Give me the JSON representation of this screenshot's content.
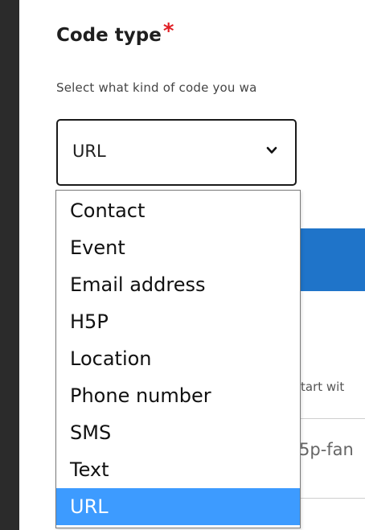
{
  "field": {
    "label": "Code type",
    "required_marker": "*",
    "description": "Select what kind of code you wa"
  },
  "select": {
    "value": "URL",
    "icon": "chevron-down-icon"
  },
  "dropdown": {
    "options": [
      {
        "label": "Contact"
      },
      {
        "label": "Event"
      },
      {
        "label": "Email address"
      },
      {
        "label": "H5P"
      },
      {
        "label": "Location"
      },
      {
        "label": "Phone number"
      },
      {
        "label": "SMS"
      },
      {
        "label": "Text"
      },
      {
        "label": "URL"
      }
    ],
    "highlighted_index": 8
  },
  "background": {
    "hint_fragment": "tart wit",
    "input_fragment": "5p-fan"
  },
  "colors": {
    "accent_blue": "#1f74c9",
    "highlight": "#3d9bff",
    "required": "#e01e24",
    "left_bar": "#2b2b2b"
  }
}
